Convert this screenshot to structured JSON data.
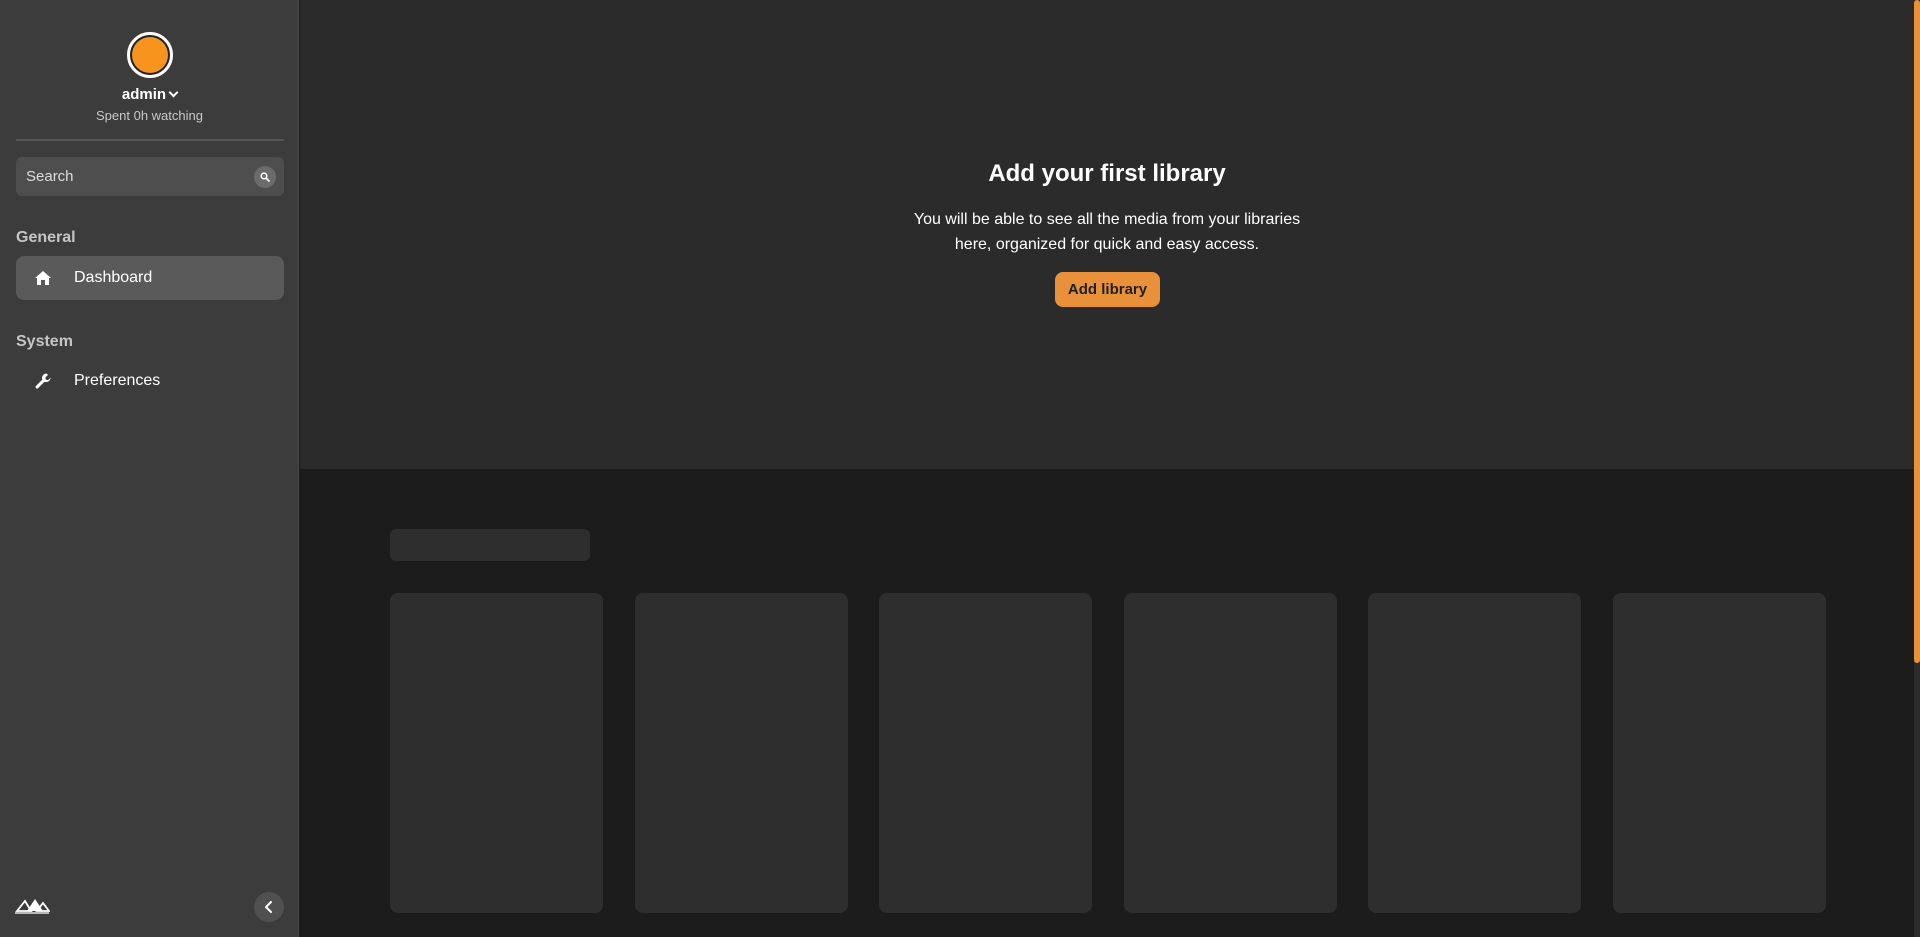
{
  "user": {
    "name": "admin",
    "subtitle": "Spent 0h watching"
  },
  "search": {
    "placeholder": "Search"
  },
  "sidebar": {
    "sections": [
      {
        "label": "General",
        "items": [
          {
            "label": "Dashboard",
            "icon": "home-icon",
            "active": true
          }
        ]
      },
      {
        "label": "System",
        "items": [
          {
            "label": "Preferences",
            "icon": "wrench-icon",
            "active": false
          }
        ]
      }
    ]
  },
  "hero": {
    "title": "Add your first library",
    "description": "You will be able to see all the media from your libraries here, organized for quick and easy access.",
    "button_label": "Add library"
  },
  "colors": {
    "accent": "#e8913a",
    "avatar": "#f7941d",
    "sidebar_bg": "#3c3c3c",
    "hero_bg": "#2b2b2b",
    "page_bg": "#1c1c1c"
  }
}
